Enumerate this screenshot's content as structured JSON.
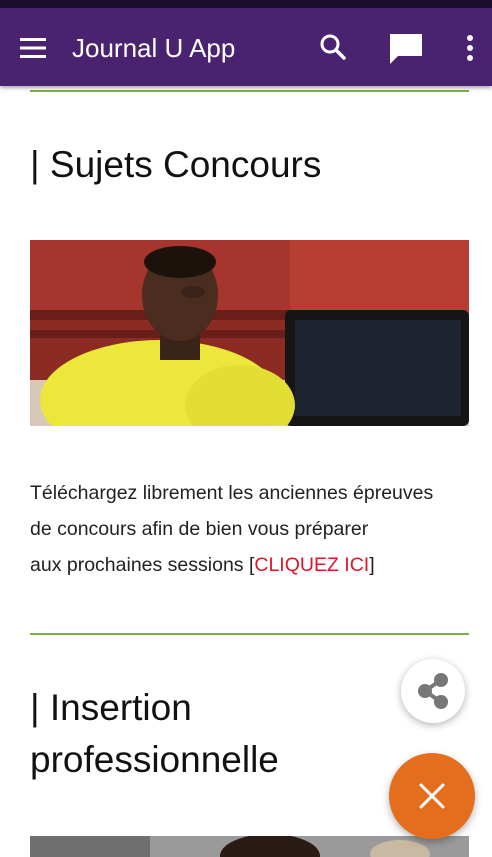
{
  "app_bar": {
    "title": "Journal U App",
    "menu_icon": "menu-icon",
    "search_icon": "search-icon",
    "chat_icon": "chat-icon",
    "more_icon": "more-vertical-icon",
    "background_color": "#4a2370"
  },
  "sections": [
    {
      "heading": "| Sujets Concours",
      "image": "student-at-computer-photo",
      "text_lines": [
        "Téléchargez librement les anciennes épreuves",
        "de concours afin de bien vous préparer",
        "aux prochaines sessions ["
      ],
      "link_label": "CLIQUEZ ICI",
      "text_after_link": "]"
    },
    {
      "heading_lines": [
        "| Insertion",
        "professionnelle"
      ],
      "image": "professional-photo"
    }
  ],
  "fabs": {
    "share_icon": "share-icon",
    "close_icon": "close-icon",
    "close_color": "#e46d1e"
  },
  "colors": {
    "divider": "#7db24a",
    "link": "#e0152c"
  }
}
